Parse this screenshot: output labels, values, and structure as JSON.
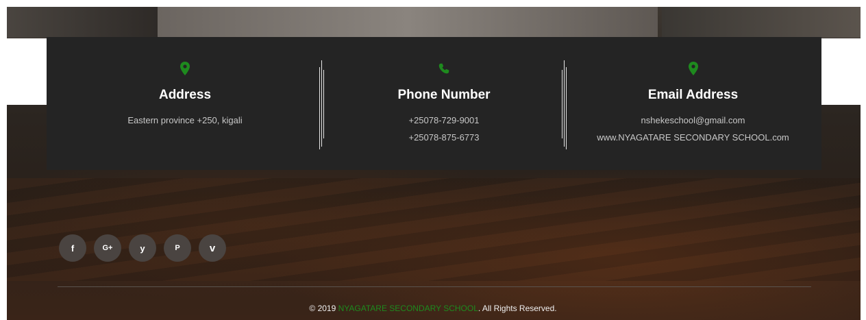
{
  "colors": {
    "accent": "#1e8a1e",
    "box": "#242424"
  },
  "contact": {
    "address": {
      "icon": "map-marker-icon",
      "title": "Address",
      "lines": [
        "Eastern province +250, kigali"
      ]
    },
    "phone": {
      "icon": "phone-icon",
      "title": "Phone Number",
      "lines": [
        "+25078-729-9001",
        "+25078-875-6773"
      ]
    },
    "email": {
      "icon": "map-marker-icon",
      "title": "Email Address",
      "lines": [
        "nshekeschool@gmail.com",
        "www.NYAGATARE SECONDARY SCHOOL.com"
      ]
    }
  },
  "social": [
    {
      "name": "facebook",
      "glyph": "f"
    },
    {
      "name": "google-plus",
      "glyph": "G+"
    },
    {
      "name": "twitter",
      "glyph": "y"
    },
    {
      "name": "pinterest",
      "glyph": "P"
    },
    {
      "name": "vimeo",
      "glyph": "v"
    }
  ],
  "footer": {
    "prefix": "© 2019 ",
    "brand": "NYAGATARE SECONDARY SCHOOL",
    "suffix": ". All Rights Reserved."
  }
}
